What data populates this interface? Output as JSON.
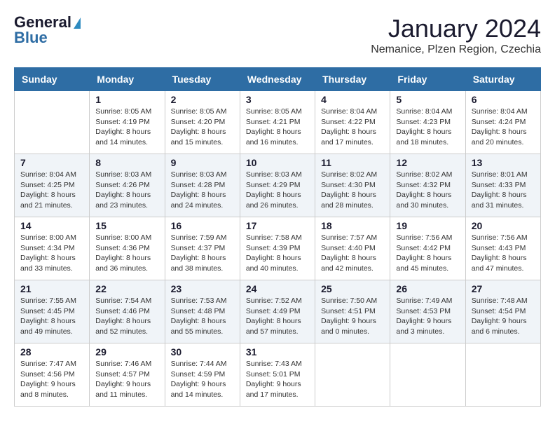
{
  "header": {
    "logo_line1": "General",
    "logo_line2": "Blue",
    "title": "January 2024",
    "subtitle": "Nemanice, Plzen Region, Czechia"
  },
  "days_of_week": [
    "Sunday",
    "Monday",
    "Tuesday",
    "Wednesday",
    "Thursday",
    "Friday",
    "Saturday"
  ],
  "weeks": [
    [
      {
        "day": "",
        "sunrise": "",
        "sunset": "",
        "daylight": ""
      },
      {
        "day": "1",
        "sunrise": "Sunrise: 8:05 AM",
        "sunset": "Sunset: 4:19 PM",
        "daylight": "Daylight: 8 hours and 14 minutes."
      },
      {
        "day": "2",
        "sunrise": "Sunrise: 8:05 AM",
        "sunset": "Sunset: 4:20 PM",
        "daylight": "Daylight: 8 hours and 15 minutes."
      },
      {
        "day": "3",
        "sunrise": "Sunrise: 8:05 AM",
        "sunset": "Sunset: 4:21 PM",
        "daylight": "Daylight: 8 hours and 16 minutes."
      },
      {
        "day": "4",
        "sunrise": "Sunrise: 8:04 AM",
        "sunset": "Sunset: 4:22 PM",
        "daylight": "Daylight: 8 hours and 17 minutes."
      },
      {
        "day": "5",
        "sunrise": "Sunrise: 8:04 AM",
        "sunset": "Sunset: 4:23 PM",
        "daylight": "Daylight: 8 hours and 18 minutes."
      },
      {
        "day": "6",
        "sunrise": "Sunrise: 8:04 AM",
        "sunset": "Sunset: 4:24 PM",
        "daylight": "Daylight: 8 hours and 20 minutes."
      }
    ],
    [
      {
        "day": "7",
        "sunrise": "Sunrise: 8:04 AM",
        "sunset": "Sunset: 4:25 PM",
        "daylight": "Daylight: 8 hours and 21 minutes."
      },
      {
        "day": "8",
        "sunrise": "Sunrise: 8:03 AM",
        "sunset": "Sunset: 4:26 PM",
        "daylight": "Daylight: 8 hours and 23 minutes."
      },
      {
        "day": "9",
        "sunrise": "Sunrise: 8:03 AM",
        "sunset": "Sunset: 4:28 PM",
        "daylight": "Daylight: 8 hours and 24 minutes."
      },
      {
        "day": "10",
        "sunrise": "Sunrise: 8:03 AM",
        "sunset": "Sunset: 4:29 PM",
        "daylight": "Daylight: 8 hours and 26 minutes."
      },
      {
        "day": "11",
        "sunrise": "Sunrise: 8:02 AM",
        "sunset": "Sunset: 4:30 PM",
        "daylight": "Daylight: 8 hours and 28 minutes."
      },
      {
        "day": "12",
        "sunrise": "Sunrise: 8:02 AM",
        "sunset": "Sunset: 4:32 PM",
        "daylight": "Daylight: 8 hours and 30 minutes."
      },
      {
        "day": "13",
        "sunrise": "Sunrise: 8:01 AM",
        "sunset": "Sunset: 4:33 PM",
        "daylight": "Daylight: 8 hours and 31 minutes."
      }
    ],
    [
      {
        "day": "14",
        "sunrise": "Sunrise: 8:00 AM",
        "sunset": "Sunset: 4:34 PM",
        "daylight": "Daylight: 8 hours and 33 minutes."
      },
      {
        "day": "15",
        "sunrise": "Sunrise: 8:00 AM",
        "sunset": "Sunset: 4:36 PM",
        "daylight": "Daylight: 8 hours and 36 minutes."
      },
      {
        "day": "16",
        "sunrise": "Sunrise: 7:59 AM",
        "sunset": "Sunset: 4:37 PM",
        "daylight": "Daylight: 8 hours and 38 minutes."
      },
      {
        "day": "17",
        "sunrise": "Sunrise: 7:58 AM",
        "sunset": "Sunset: 4:39 PM",
        "daylight": "Daylight: 8 hours and 40 minutes."
      },
      {
        "day": "18",
        "sunrise": "Sunrise: 7:57 AM",
        "sunset": "Sunset: 4:40 PM",
        "daylight": "Daylight: 8 hours and 42 minutes."
      },
      {
        "day": "19",
        "sunrise": "Sunrise: 7:56 AM",
        "sunset": "Sunset: 4:42 PM",
        "daylight": "Daylight: 8 hours and 45 minutes."
      },
      {
        "day": "20",
        "sunrise": "Sunrise: 7:56 AM",
        "sunset": "Sunset: 4:43 PM",
        "daylight": "Daylight: 8 hours and 47 minutes."
      }
    ],
    [
      {
        "day": "21",
        "sunrise": "Sunrise: 7:55 AM",
        "sunset": "Sunset: 4:45 PM",
        "daylight": "Daylight: 8 hours and 49 minutes."
      },
      {
        "day": "22",
        "sunrise": "Sunrise: 7:54 AM",
        "sunset": "Sunset: 4:46 PM",
        "daylight": "Daylight: 8 hours and 52 minutes."
      },
      {
        "day": "23",
        "sunrise": "Sunrise: 7:53 AM",
        "sunset": "Sunset: 4:48 PM",
        "daylight": "Daylight: 8 hours and 55 minutes."
      },
      {
        "day": "24",
        "sunrise": "Sunrise: 7:52 AM",
        "sunset": "Sunset: 4:49 PM",
        "daylight": "Daylight: 8 hours and 57 minutes."
      },
      {
        "day": "25",
        "sunrise": "Sunrise: 7:50 AM",
        "sunset": "Sunset: 4:51 PM",
        "daylight": "Daylight: 9 hours and 0 minutes."
      },
      {
        "day": "26",
        "sunrise": "Sunrise: 7:49 AM",
        "sunset": "Sunset: 4:53 PM",
        "daylight": "Daylight: 9 hours and 3 minutes."
      },
      {
        "day": "27",
        "sunrise": "Sunrise: 7:48 AM",
        "sunset": "Sunset: 4:54 PM",
        "daylight": "Daylight: 9 hours and 6 minutes."
      }
    ],
    [
      {
        "day": "28",
        "sunrise": "Sunrise: 7:47 AM",
        "sunset": "Sunset: 4:56 PM",
        "daylight": "Daylight: 9 hours and 8 minutes."
      },
      {
        "day": "29",
        "sunrise": "Sunrise: 7:46 AM",
        "sunset": "Sunset: 4:57 PM",
        "daylight": "Daylight: 9 hours and 11 minutes."
      },
      {
        "day": "30",
        "sunrise": "Sunrise: 7:44 AM",
        "sunset": "Sunset: 4:59 PM",
        "daylight": "Daylight: 9 hours and 14 minutes."
      },
      {
        "day": "31",
        "sunrise": "Sunrise: 7:43 AM",
        "sunset": "Sunset: 5:01 PM",
        "daylight": "Daylight: 9 hours and 17 minutes."
      },
      {
        "day": "",
        "sunrise": "",
        "sunset": "",
        "daylight": ""
      },
      {
        "day": "",
        "sunrise": "",
        "sunset": "",
        "daylight": ""
      },
      {
        "day": "",
        "sunrise": "",
        "sunset": "",
        "daylight": ""
      }
    ]
  ]
}
